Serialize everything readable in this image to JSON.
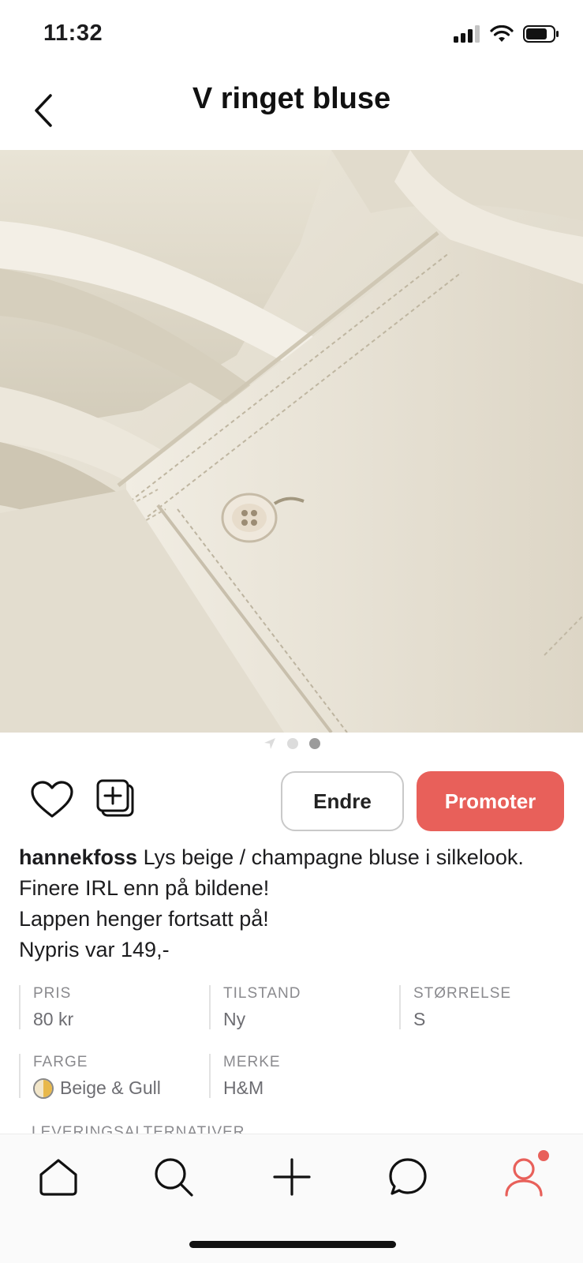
{
  "status_bar": {
    "time": "11:32"
  },
  "header": {
    "title": "V ringet bluse"
  },
  "pager": {
    "total": 2,
    "active_index": 1
  },
  "actions": {
    "edit_label": "Endre",
    "promote_label": "Promoter"
  },
  "description": {
    "username": "hannekfoss",
    "first_line": "Lys beige / champagne bluse i silkelook.",
    "lines": [
      "Finere IRL enn på bildene!",
      "Lappen henger fortsatt på!",
      "Nypris var 149,-"
    ]
  },
  "attributes": {
    "pris": {
      "label": "PRIS",
      "value": "80 kr"
    },
    "tilstand": {
      "label": "TILSTAND",
      "value": "Ny"
    },
    "storrelse": {
      "label": "STØRRELSE",
      "value": "S"
    },
    "farge": {
      "label": "FARGE",
      "value": "Beige & Gull",
      "swatch_colors": [
        "#f2e6c9",
        "#e8b84a"
      ]
    },
    "merke": {
      "label": "MERKE",
      "value": "H&M"
    }
  },
  "delivery": {
    "label": "LEVERINGSALTERNATIVER"
  },
  "colors": {
    "accent": "#e8605a",
    "image_bg": "#e6e1d4"
  },
  "bottom_nav": [
    {
      "id": "home",
      "icon": "home-icon"
    },
    {
      "id": "search",
      "icon": "search-icon"
    },
    {
      "id": "add",
      "icon": "plus-icon"
    },
    {
      "id": "messages",
      "icon": "chat-bubble-icon"
    },
    {
      "id": "profile",
      "icon": "profile-icon",
      "has_notification": true
    }
  ]
}
